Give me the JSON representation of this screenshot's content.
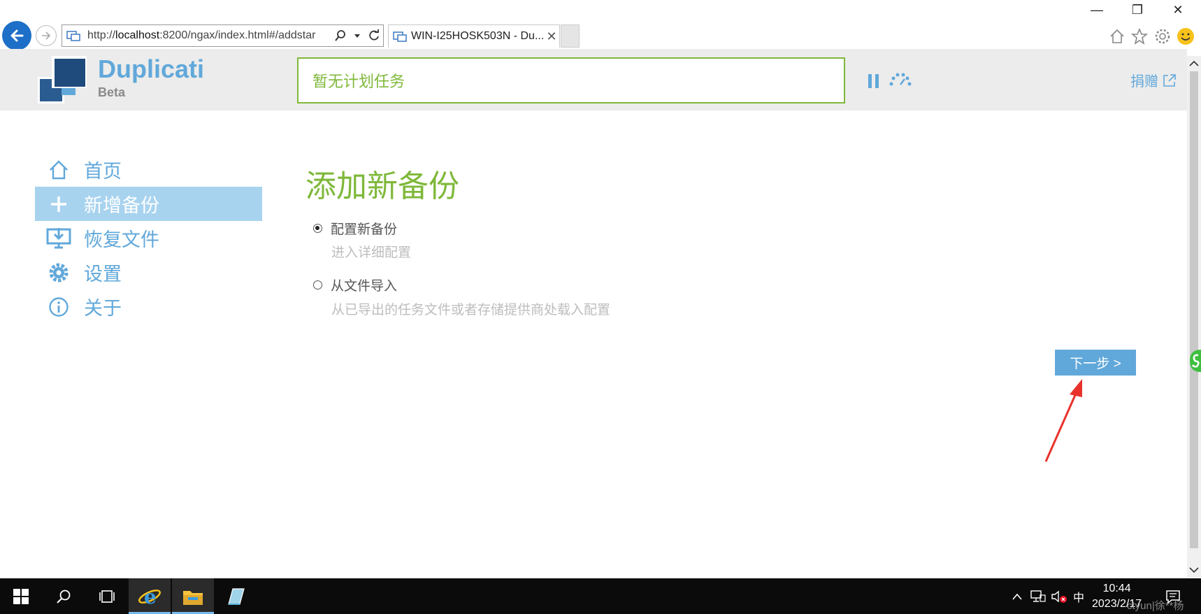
{
  "browser": {
    "url_prefix": "http://",
    "url_host": "localhost",
    "url_rest": ":8200/ngax/index.html#/addstar",
    "tab_title": "WIN-I25HOSK503N - Du...",
    "tab_close": "✕"
  },
  "window_controls": {
    "minimize": "—",
    "restore": "❐",
    "close": "✕"
  },
  "header": {
    "brand": "Duplicati",
    "brand_sub": "Beta",
    "status": "暂无计划任务",
    "donate": "捐赠"
  },
  "nav": {
    "items": [
      {
        "label": "首页",
        "icon": "home-icon",
        "active": false
      },
      {
        "label": "新增备份",
        "icon": "plus-icon",
        "active": true
      },
      {
        "label": "恢复文件",
        "icon": "restore-icon",
        "active": false
      },
      {
        "label": "设置",
        "icon": "gear-icon",
        "active": false
      },
      {
        "label": "关于",
        "icon": "info-icon",
        "active": false
      }
    ]
  },
  "main": {
    "title": "添加新备份",
    "options": [
      {
        "label": "配置新备份",
        "desc": "进入详细配置",
        "selected": true
      },
      {
        "label": "从文件导入",
        "desc": "从已导出的任务文件或者存储提供商处载入配置",
        "selected": false
      }
    ],
    "next_button": "下一步 >"
  },
  "taskbar": {
    "ime": "中",
    "time": "10:44",
    "date": "2023/2/17"
  },
  "watermark": "ctyun|徐**杨",
  "colors": {
    "accent_blue": "#61a8da",
    "accent_green": "#7fb83a",
    "nav_active_bg": "#a8d3ef",
    "annotation_red": "#e8322b"
  }
}
